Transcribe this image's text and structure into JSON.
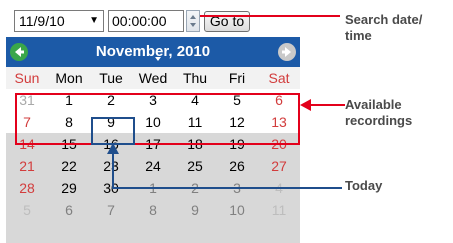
{
  "toolbar": {
    "date_value": "11/9/10",
    "time_value": "00:00:00",
    "go_label": "Go to"
  },
  "calendar": {
    "title": "November, 2010",
    "weekdays": [
      "Sun",
      "Mon",
      "Tue",
      "Wed",
      "Thu",
      "Fri",
      "Sat"
    ],
    "weeks": [
      [
        "31",
        "1",
        "2",
        "3",
        "4",
        "5",
        "6"
      ],
      [
        "7",
        "8",
        "9",
        "10",
        "11",
        "12",
        "13"
      ],
      [
        "14",
        "15",
        "16",
        "17",
        "18",
        "19",
        "20"
      ],
      [
        "21",
        "22",
        "23",
        "24",
        "25",
        "26",
        "27"
      ],
      [
        "28",
        "29",
        "30",
        "1",
        "2",
        "3",
        "4"
      ],
      [
        "5",
        "6",
        "7",
        "8",
        "9",
        "10",
        "11"
      ]
    ],
    "today": "9"
  },
  "annotations": {
    "search_line1": "Search date/",
    "search_line2": "time",
    "available_line1": "Available",
    "available_line2": "recordings",
    "today": "Today"
  },
  "colors": {
    "header_blue": "#1c5aa7",
    "weekend_red": "#d23c3c",
    "annotation_red": "#e3001b",
    "annotation_blue": "#1f4e8c"
  }
}
